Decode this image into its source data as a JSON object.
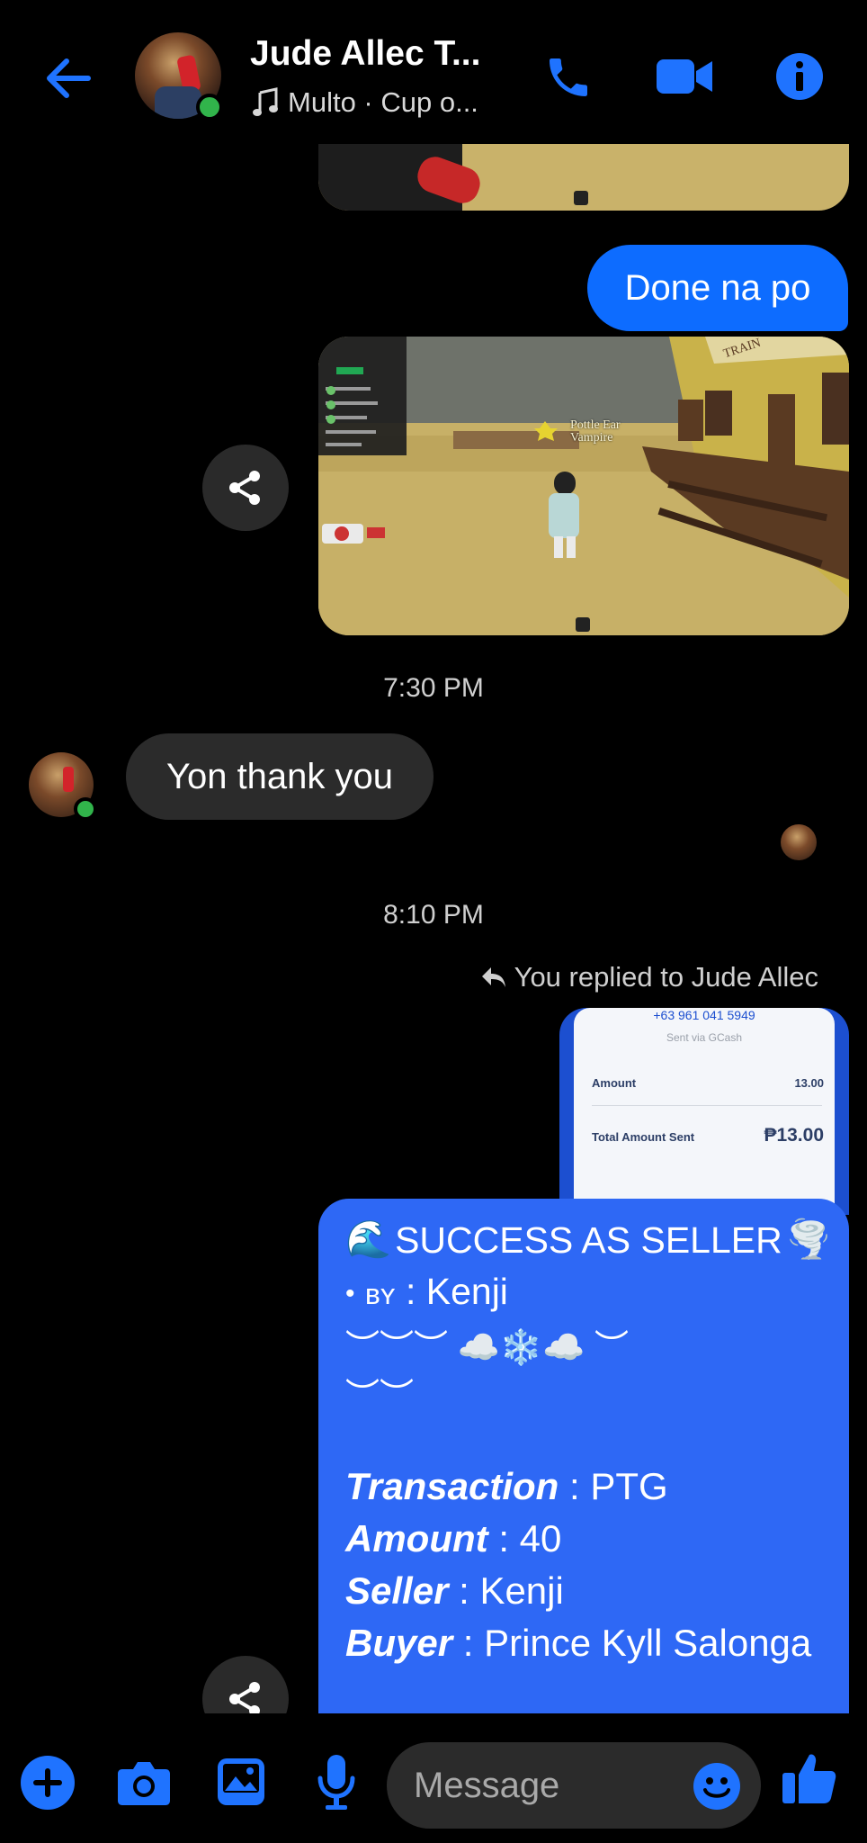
{
  "header": {
    "title": "Jude Allec T...",
    "subtitle": "Multo · Cup o...",
    "icons": [
      "back-arrow-icon",
      "phone-icon",
      "video-camera-icon",
      "info-icon",
      "music-note-icon"
    ]
  },
  "messages": {
    "outgoing_1": "Done na po",
    "timestamp_1": "7:30 PM",
    "incoming_1": "Yon thank you",
    "timestamp_2": "8:10 PM",
    "reply_label": "You replied to Jude Allec"
  },
  "game_screenshot": {
    "sign_line1": "Pottle Ear",
    "sign_line2": "Vampire",
    "building_sign": "TRAIN"
  },
  "receipt": {
    "phone": "+63 961 041 5949",
    "via": "Sent via GCash",
    "amount_label": "Amount",
    "amount_value": "13.00",
    "total_label": "Total Amount Sent",
    "total_value": "₱13.00"
  },
  "card": {
    "title": "SUCCESS AS SELLER",
    "by_label": "ʙʏ",
    "by_value": "Kenji",
    "decor_line1": "︶︶︶ ☁️❄️☁️ ︶",
    "decor_line2": "︶︶",
    "rows": [
      {
        "label": "Transaction",
        "value": "PTG"
      },
      {
        "label": "Amount",
        "value": "40"
      },
      {
        "label": "Seller",
        "value": "Kenji"
      },
      {
        "label": "Buyer",
        "value": "Prince Kyll Salonga"
      }
    ]
  },
  "composer": {
    "placeholder": "Message"
  },
  "colors": {
    "accent": "#0d6cff",
    "icon_blue": "#1f73ff",
    "online": "#31b44b",
    "incoming_bubble": "#2b2b2b",
    "card_blue": "#2e68f5"
  }
}
